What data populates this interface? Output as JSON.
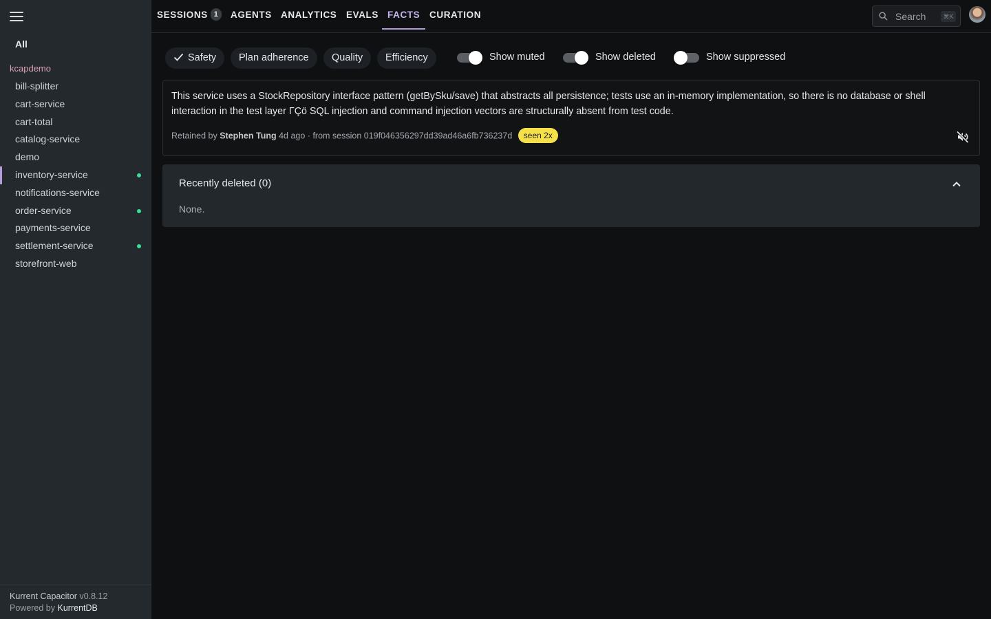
{
  "sidebar": {
    "all_label": "All",
    "group_label": "kcapdemo",
    "items": [
      {
        "label": "bill-splitter",
        "active": false,
        "dot": false
      },
      {
        "label": "cart-service",
        "active": false,
        "dot": false
      },
      {
        "label": "cart-total",
        "active": false,
        "dot": false
      },
      {
        "label": "catalog-service",
        "active": false,
        "dot": false
      },
      {
        "label": "demo",
        "active": false,
        "dot": false
      },
      {
        "label": "inventory-service",
        "active": true,
        "dot": true
      },
      {
        "label": "notifications-service",
        "active": false,
        "dot": false
      },
      {
        "label": "order-service",
        "active": false,
        "dot": true
      },
      {
        "label": "payments-service",
        "active": false,
        "dot": false
      },
      {
        "label": "settlement-service",
        "active": false,
        "dot": true
      },
      {
        "label": "storefront-web",
        "active": false,
        "dot": false
      }
    ],
    "footer": {
      "product": "Kurrent Capacitor",
      "version": "v0.8.12",
      "powered_prefix": "Powered by",
      "powered_name": "KurrentDB"
    }
  },
  "nav": {
    "tabs": [
      {
        "label": "SESSIONS",
        "badge": "1"
      },
      {
        "label": "AGENTS"
      },
      {
        "label": "ANALYTICS"
      },
      {
        "label": "EVALS"
      },
      {
        "label": "FACTS",
        "active": true
      },
      {
        "label": "CURATION"
      }
    ],
    "search": {
      "label": "Search",
      "shortcut": "⌘K"
    }
  },
  "filters": {
    "chips": [
      {
        "label": "Safety",
        "checked": true
      },
      {
        "label": "Plan adherence",
        "checked": false
      },
      {
        "label": "Quality",
        "checked": false
      },
      {
        "label": "Efficiency",
        "checked": false
      }
    ],
    "toggles": [
      {
        "label": "Show muted",
        "on": true
      },
      {
        "label": "Show deleted",
        "on": true
      },
      {
        "label": "Show suppressed",
        "on": false
      }
    ]
  },
  "fact": {
    "text": "This service uses a StockRepository interface pattern (getBySku/save) that abstracts all persistence; tests use an in-memory implementation, so there is no database or shell interaction in the test layer ΓÇö SQL injection and command injection vectors are structurally absent from test code.",
    "retained_prefix": "Retained by",
    "author": "Stephen Tung",
    "age": "4d ago",
    "session_text": "· from session 019f046356297dd39ad46a6fb736237d",
    "seen_badge": "seen 2x"
  },
  "deleted": {
    "title": "Recently deleted (0)",
    "empty_text": "None."
  },
  "colors": {
    "accent": "#b39ddb",
    "status_dot": "#3ddc97",
    "seen_badge": "#f5e04a",
    "group_label": "#d8a2b4"
  }
}
